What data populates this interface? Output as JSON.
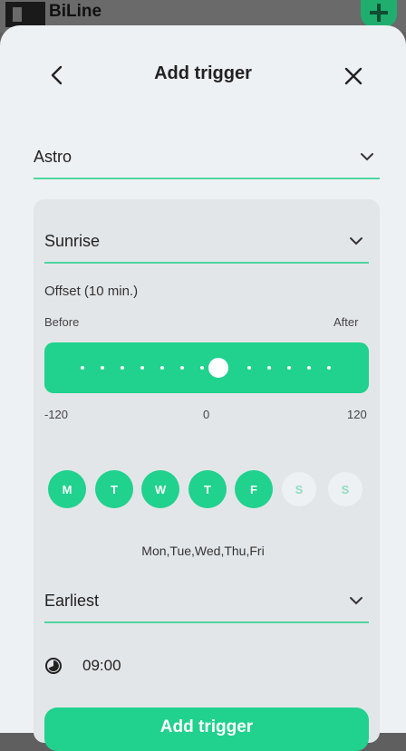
{
  "background_app": {
    "title": "BiLine"
  },
  "header": {
    "title": "Add trigger"
  },
  "trigger_type": {
    "value": "Astro"
  },
  "event": {
    "value": "Sunrise"
  },
  "offset": {
    "label": "Offset (10 min.)",
    "before_label": "Before",
    "after_label": "After",
    "min_label": "-120",
    "mid_label": "0",
    "max_label": "120",
    "value_minutes": 10,
    "range": [
      -120,
      120
    ]
  },
  "days": [
    {
      "label": "M",
      "selected": true
    },
    {
      "label": "T",
      "selected": true
    },
    {
      "label": "W",
      "selected": true
    },
    {
      "label": "T",
      "selected": true
    },
    {
      "label": "F",
      "selected": true
    },
    {
      "label": "S",
      "selected": false
    },
    {
      "label": "S",
      "selected": false
    }
  ],
  "days_summary": "Mon,Tue,Wed,Thu,Fri",
  "constraint": {
    "value": "Earliest"
  },
  "time": {
    "value": "09:00",
    "icon": "clock-icon"
  },
  "add_button": {
    "label": "Add trigger"
  },
  "colors": {
    "accent": "#21d18e",
    "underline": "#4fd6a0",
    "sheet_bg": "#eef1f4",
    "card_bg": "#e3e6e9"
  }
}
